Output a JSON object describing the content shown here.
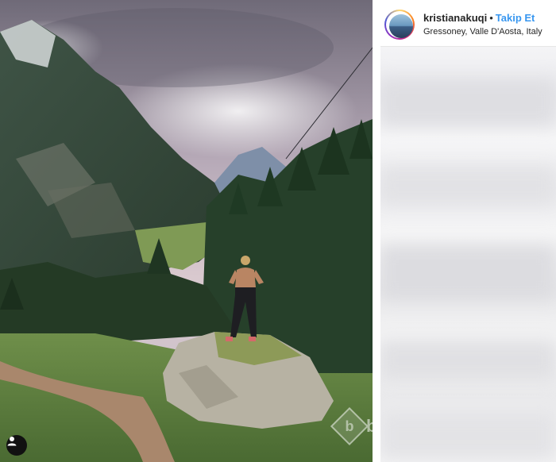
{
  "post": {
    "username": "kristianakuqi",
    "separator": "•",
    "follow_label": "Takip Et",
    "location": "Gressoney, Valle D'Aosta, Italy"
  },
  "photo": {
    "description_icon": "user-tag-icon"
  },
  "watermark": {
    "icon_letter": "b",
    "text": "burs"
  },
  "colors": {
    "follow_blue": "#3897f0",
    "text_dark": "#262626"
  }
}
